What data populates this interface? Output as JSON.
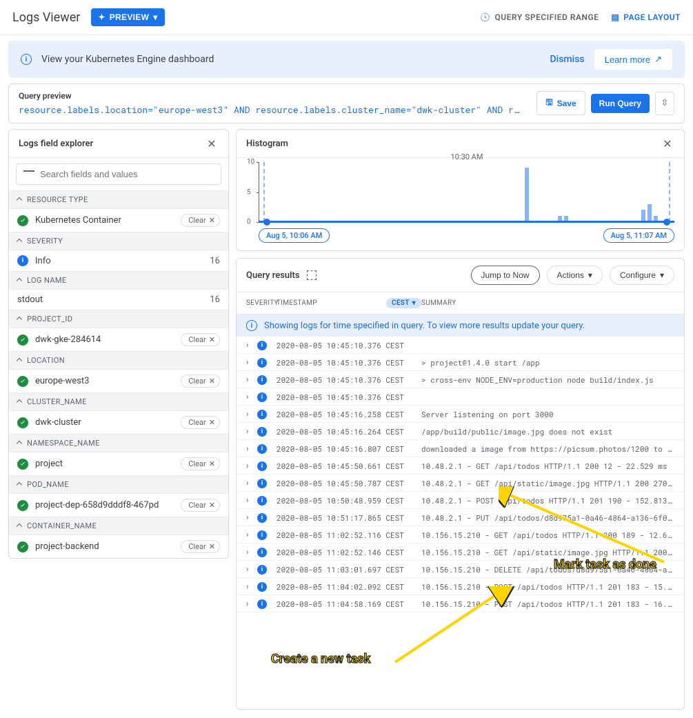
{
  "header": {
    "title": "Logs Viewer",
    "preview_label": "PREVIEW",
    "query_range_label": "QUERY SPECIFIED RANGE",
    "page_layout_label": "PAGE LAYOUT"
  },
  "banner": {
    "text": "View your Kubernetes Engine dashboard",
    "dismiss": "Dismiss",
    "learn_more": "Learn more"
  },
  "query_preview": {
    "title": "Query preview",
    "query": "resource.labels.location=\"europe-west3\" AND resource.labels.cluster_name=\"dwk-cluster\" AND r…",
    "save_label": "Save",
    "run_label": "Run Query"
  },
  "explorer": {
    "title": "Logs field explorer",
    "search_placeholder": "Search fields and values",
    "sections": {
      "resource_type": {
        "label": "RESOURCE TYPE",
        "item": "Kubernetes Container",
        "clear": "Clear"
      },
      "severity": {
        "label": "SEVERITY",
        "item": "Info",
        "count": "16"
      },
      "log_name": {
        "label": "LOG NAME",
        "item": "stdout",
        "count": "16"
      },
      "project_id": {
        "label": "PROJECT_ID",
        "item": "dwk-gke-284614",
        "clear": "Clear"
      },
      "location": {
        "label": "LOCATION",
        "item": "europe-west3",
        "clear": "Clear"
      },
      "cluster_name": {
        "label": "CLUSTER_NAME",
        "item": "dwk-cluster",
        "clear": "Clear"
      },
      "namespace_name": {
        "label": "NAMESPACE_NAME",
        "item": "project",
        "clear": "Clear"
      },
      "pod_name": {
        "label": "POD_NAME",
        "item": "project-dep-658d9dddf8-467pd",
        "clear": "Clear"
      },
      "container_name": {
        "label": "CONTAINER_NAME",
        "item": "project-backend",
        "clear": "Clear"
      }
    }
  },
  "histogram": {
    "title": "Histogram",
    "yticks": [
      "10",
      "5",
      "0"
    ],
    "start_label": "Aug 5, 10:06 AM",
    "center_label": "10:30 AM",
    "end_label": "Aug 5, 11:07 AM"
  },
  "chart_data": {
    "type": "bar",
    "title": "Histogram",
    "ylabel": "",
    "ylim": [
      0,
      10
    ],
    "x_range": [
      "Aug 5, 10:06 AM",
      "Aug 5, 11:07 AM"
    ],
    "bars": [
      {
        "x_frac": 0.64,
        "value": 9
      },
      {
        "x_frac": 0.72,
        "value": 1
      },
      {
        "x_frac": 0.735,
        "value": 1
      },
      {
        "x_frac": 0.92,
        "value": 2
      },
      {
        "x_frac": 0.935,
        "value": 3
      },
      {
        "x_frac": 0.95,
        "value": 1
      }
    ]
  },
  "results": {
    "title": "Query results",
    "jump_label": "Jump to Now",
    "actions_label": "Actions",
    "configure_label": "Configure",
    "col_severity": "SEVERITY",
    "col_timestamp": "TIMESTAMP",
    "timezone": "CEST",
    "col_summary": "SUMMARY",
    "info_text": "Showing logs for time specified in query. To view more results update your query.",
    "rows": [
      {
        "ts": "2020-08-05 10:45:10.376 CEST",
        "sum": ""
      },
      {
        "ts": "2020-08-05 10:45:10.376 CEST",
        "sum": "> project@1.4.0 start /app"
      },
      {
        "ts": "2020-08-05 10:45:10.376 CEST",
        "sum": "> cross-env NODE_ENV=production node build/index.js"
      },
      {
        "ts": "2020-08-05 10:45:10.376 CEST",
        "sum": ""
      },
      {
        "ts": "2020-08-05 10:45:16.258 CEST",
        "sum": "Server listening on port 3000"
      },
      {
        "ts": "2020-08-05 10:45:16.264 CEST",
        "sum": "/app/build/public/image.jpg does not exist"
      },
      {
        "ts": "2020-08-05 10:45:16.807 CEST",
        "sum": "downloaded a image from https://picsum.photos/1200 to /…"
      },
      {
        "ts": "2020-08-05 10:45:50.661 CEST",
        "sum": "10.48.2.1 - GET /api/todos HTTP/1.1 200 12 - 22.529 ms"
      },
      {
        "ts": "2020-08-05 10:45:50.787 CEST",
        "sum": "10.48.2.1 - GET /api/static/image.jpg HTTP/1.1 200 2708…"
      },
      {
        "ts": "2020-08-05 10:50:48.959 CEST",
        "sum": "10.48.2.1 - POST /api/todos HTTP/1.1 201 190 - 152.813 …"
      },
      {
        "ts": "2020-08-05 10:51:17.865 CEST",
        "sum": "10.48.2.1 - PUT /api/todos/d8d975a1-0a46-4864-a136-6f0c…"
      },
      {
        "ts": "2020-08-05 11:02:52.116 CEST",
        "sum": "10.156.15.210 - GET /api/todos HTTP/1.1 200 189 - 12.69…"
      },
      {
        "ts": "2020-08-05 11:02:52.146 CEST",
        "sum": "10.156.15.210 - GET /api/static/image.jpg HTTP/1.1 200 …"
      },
      {
        "ts": "2020-08-05 11:03:01.697 CEST",
        "sum": "10.156.15.210 - DELETE /api/todos/d8d975a1-0a46-4864-a1…"
      },
      {
        "ts": "2020-08-05 11:04:02.092 CEST",
        "sum": "10.156.15.210 - POST /api/todos HTTP/1.1 201 183 - 15.2…"
      },
      {
        "ts": "2020-08-05 11:04:58.169 CEST",
        "sum": "10.156.15.210 - POST /api/todos HTTP/1.1 201 183 - 16.1…"
      }
    ]
  },
  "annotations": {
    "mark_done": "Mark task as done",
    "create_task": "Create a new task"
  }
}
